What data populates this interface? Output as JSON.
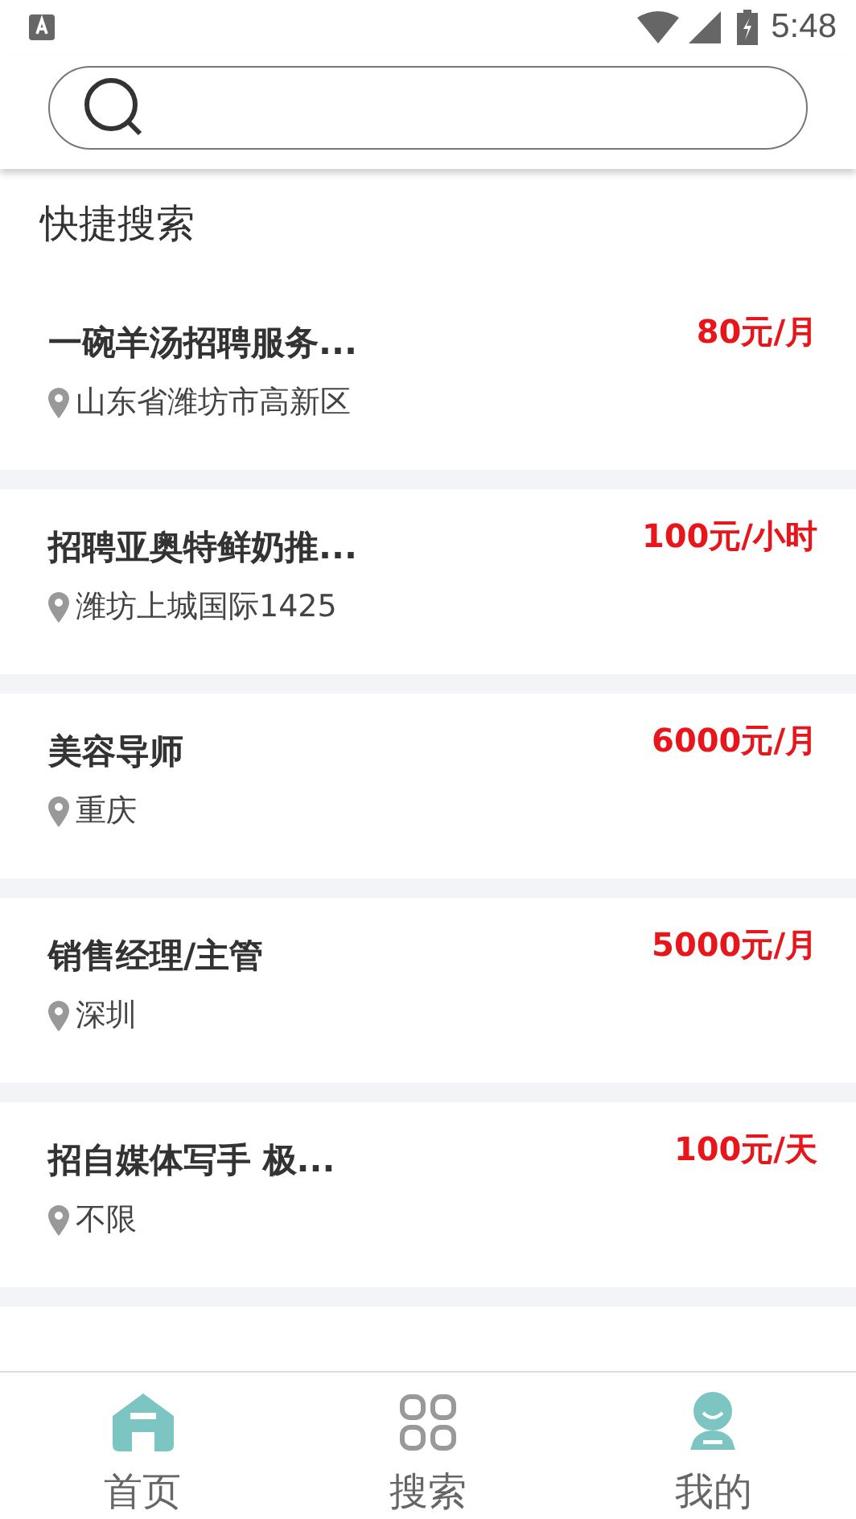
{
  "status_bar": {
    "time": "5:48"
  },
  "section_title": "快捷搜索",
  "jobs": [
    {
      "title": "一碗羊汤招聘服务...",
      "location": "山东省潍坊市高新区",
      "salary": "80元/月"
    },
    {
      "title": "招聘亚奥特鲜奶推...",
      "location": "潍坊上城国际1425",
      "salary": "100元/小时"
    },
    {
      "title": "美容导师",
      "location": "重庆",
      "salary": "6000元/月"
    },
    {
      "title": "销售经理/主管",
      "location": "深圳",
      "salary": "5000元/月"
    },
    {
      "title": "招自媒体写手 极...",
      "location": "不限",
      "salary": "100元/天"
    }
  ],
  "nav": [
    {
      "kind": "home",
      "label": "首页"
    },
    {
      "kind": "grid",
      "label": "搜索"
    },
    {
      "kind": "person",
      "label": "我的"
    }
  ]
}
